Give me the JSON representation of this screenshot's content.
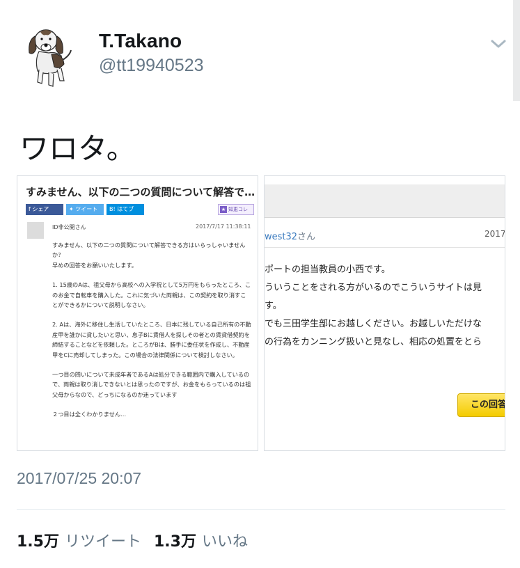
{
  "author": {
    "display_name": "T.Takano",
    "handle": "@tt19940523",
    "avatar_icon": "beagle-avatar-icon"
  },
  "tweet": {
    "text": "ワロタ。",
    "timestamp": "2017/07/25 20:07"
  },
  "stats": {
    "retweets_count": "1.5万",
    "retweets_label": "リツイート",
    "likes_count": "1.3万",
    "likes_label": "いいね"
  },
  "media": {
    "left": {
      "title": "すみません、以下の二つの質問について解答で…",
      "share": {
        "facebook": "シェア",
        "twitter": "ツイート",
        "hatena": "はてブ"
      },
      "chie_badge": "知恵コレ",
      "user": "ID非公開さん",
      "date": "2017/7/17 11:38:11",
      "body": [
        "すみません、以下の二つの質問について解答できる方はいらっしゃいませんか？",
        "早めの回答をお願いいたします。",
        "",
        "1. 15歳のAは、祖父母から高校への入学祝として5万円をもらったところ、このお金で自転車を購入した。これに気づいた両親は、この契約を取り消すことができるかについて説明しなさい。",
        "",
        "2. Aは、海外に移住し生活していたところ、日本に残している自己所有の不動産甲を誰かに貸したいと思い、息子Bに賃借人を探しその者との賃貸借契約を締結することなどを依頼した。ところがBは、勝手に委任状を作成し、不動産甲をCに売却してしまった。この場合の法律関係について検討しなさい。",
        "",
        "一つ目の問いについて未成年者であるAは処分できる範囲内で購入しているので、両親は取り消しできないとは思ったのですが、お金をもらっているのは祖父母からなので、どっちになるのか迷っています",
        "",
        "２つ目は全くわかりません…"
      ]
    },
    "right": {
      "user_name": "west32",
      "user_suffix": "さん",
      "date": "2017",
      "body": [
        "ポートの担当教員の小西です。",
        "ういうことをされる方がいるのでこういうサイトは見",
        "す。",
        "でも三田学生部にお越しください。お越しいただけな",
        "の行為をカンニング扱いと見なし、相応の処置をとら"
      ],
      "button_label": "この回答"
    }
  },
  "colors": {
    "text_primary": "#14171a",
    "text_secondary": "#657786",
    "divider": "#e1e8ed",
    "answer_button": "#f4cc00"
  }
}
